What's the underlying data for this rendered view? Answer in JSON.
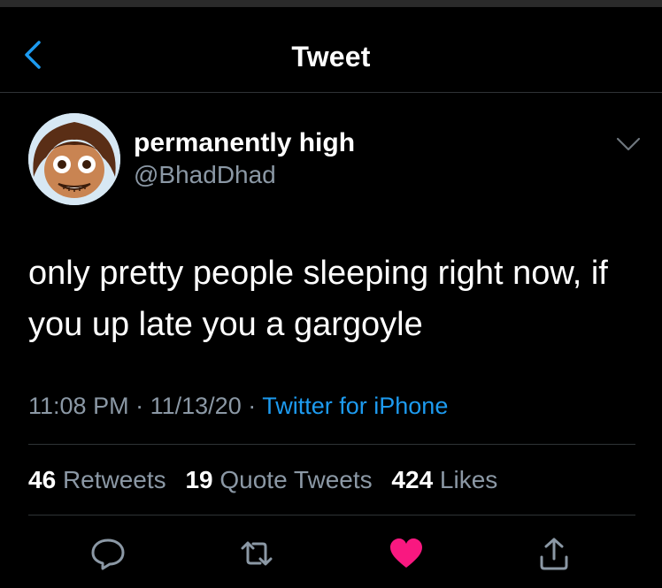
{
  "header": {
    "title": "Tweet",
    "back_icon": "chevron-left-icon"
  },
  "user": {
    "display_name": "permanently high",
    "handle": "@BhadDhad",
    "avatar_icon": "avatar-image"
  },
  "tweet": {
    "text": "only pretty people sleeping right now, if you up late you a gargoyle",
    "time": "11:08 PM",
    "date": "11/13/20",
    "separator": "·",
    "source": "Twitter for iPhone"
  },
  "stats": {
    "retweets_count": "46",
    "retweets_label": "Retweets",
    "quotes_count": "19",
    "quotes_label": "Quote Tweets",
    "likes_count": "424",
    "likes_label": "Likes"
  },
  "actions": {
    "reply_icon": "reply-icon",
    "retweet_icon": "retweet-icon",
    "like_icon": "heart-icon",
    "share_icon": "share-icon"
  },
  "colors": {
    "background": "#000000",
    "accent": "#1d9bf0",
    "secondary_text": "#8b98a5",
    "like": "#f91880",
    "divider": "#2f3336"
  }
}
